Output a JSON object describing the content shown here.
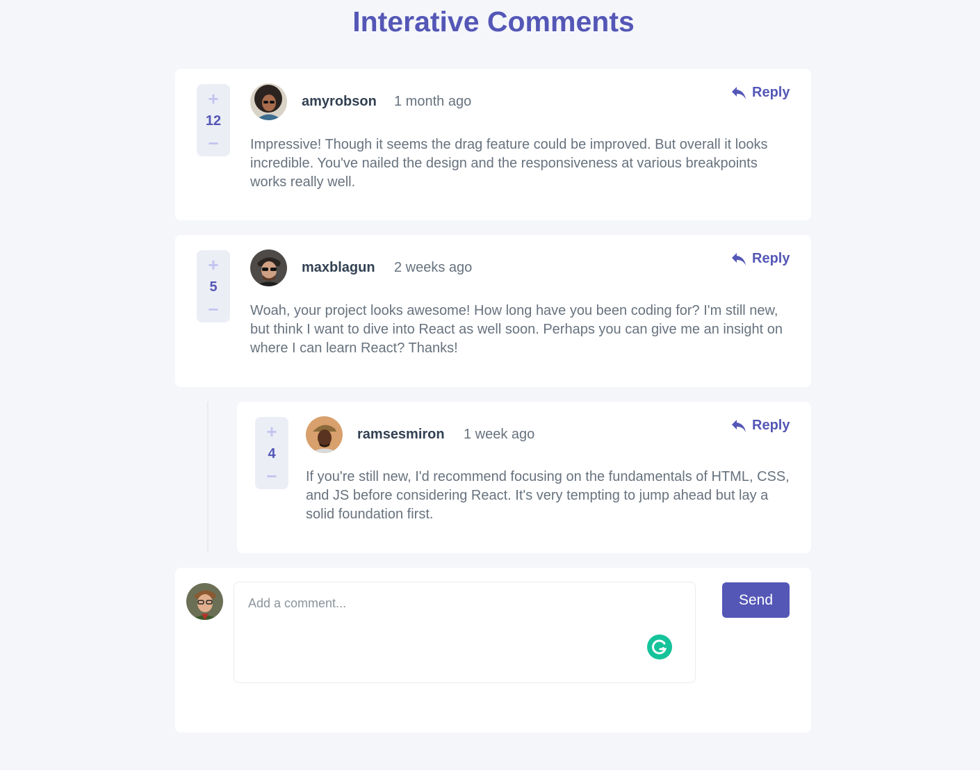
{
  "page": {
    "title": "Interative Comments"
  },
  "colors": {
    "accent": "#5457b6",
    "accent_light": "#c3c4ef",
    "card_bg": "#ffffff",
    "page_bg": "#f5f6fa",
    "heading_text": "#324152",
    "body_text": "#67727e",
    "grammarly": "#15c39a"
  },
  "comments": [
    {
      "username": "amyrobson",
      "timestamp": "1 month ago",
      "score": "12",
      "reply_label": "Reply",
      "body": "Impressive! Though it seems the drag feature could be improved. But overall it looks incredible. You've nailed the design and the responsiveness at various breakpoints works really well.",
      "avatar_icon": "avatar-amyrobson"
    },
    {
      "username": "maxblagun",
      "timestamp": "2 weeks ago",
      "score": "5",
      "reply_label": "Reply",
      "body": "Woah, your project looks awesome! How long have you been coding for? I'm still new, but think I want to dive into React as well soon. Perhaps you can give me an insight on where I can learn React? Thanks!",
      "avatar_icon": "avatar-maxblagun",
      "replies": [
        {
          "username": "ramsesmiron",
          "timestamp": "1 week ago",
          "score": "4",
          "reply_label": "Reply",
          "body": "If you're still new, I'd recommend focusing on the fundamentals of HTML, CSS, and JS before considering React. It's very tempting to jump ahead but lay a solid foundation first.",
          "avatar_icon": "avatar-ramsesmiron"
        }
      ]
    }
  ],
  "vote_icons": {
    "upvote": "+",
    "downvote": "−"
  },
  "new_comment": {
    "placeholder": "Add a comment...",
    "send_label": "Send",
    "avatar_icon": "avatar-current-user",
    "assistant_icon": "grammarly-icon"
  }
}
